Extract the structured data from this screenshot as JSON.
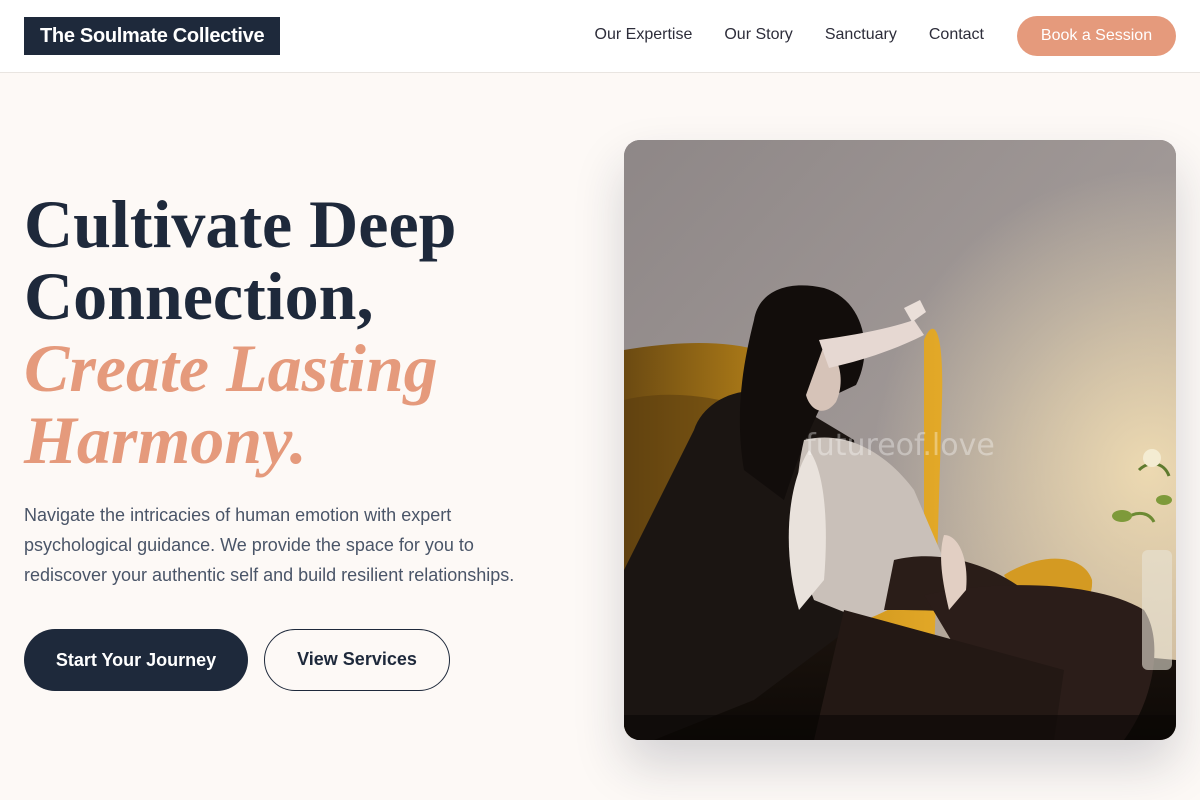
{
  "nav": {
    "logo": "The Soulmate Collective",
    "links": [
      "Our Expertise",
      "Our Story",
      "Sanctuary",
      "Contact"
    ],
    "cta": "Book a Session"
  },
  "hero": {
    "title_line1": "Cultivate Deep",
    "title_line2": "Connection,",
    "title_accent_line1": "Create Lasting",
    "title_accent_line2": "Harmony.",
    "description": "Navigate the intricacies of human emotion with expert psychological guidance. We provide the space for you to rediscover your authentic self and build resilient relationships.",
    "primary_button": "Start Your Journey",
    "secondary_button": "View Services",
    "image_watermark": "futureof.love"
  },
  "colors": {
    "navy": "#1e293b",
    "accent": "#e59a7c",
    "background": "#fdf9f6"
  }
}
